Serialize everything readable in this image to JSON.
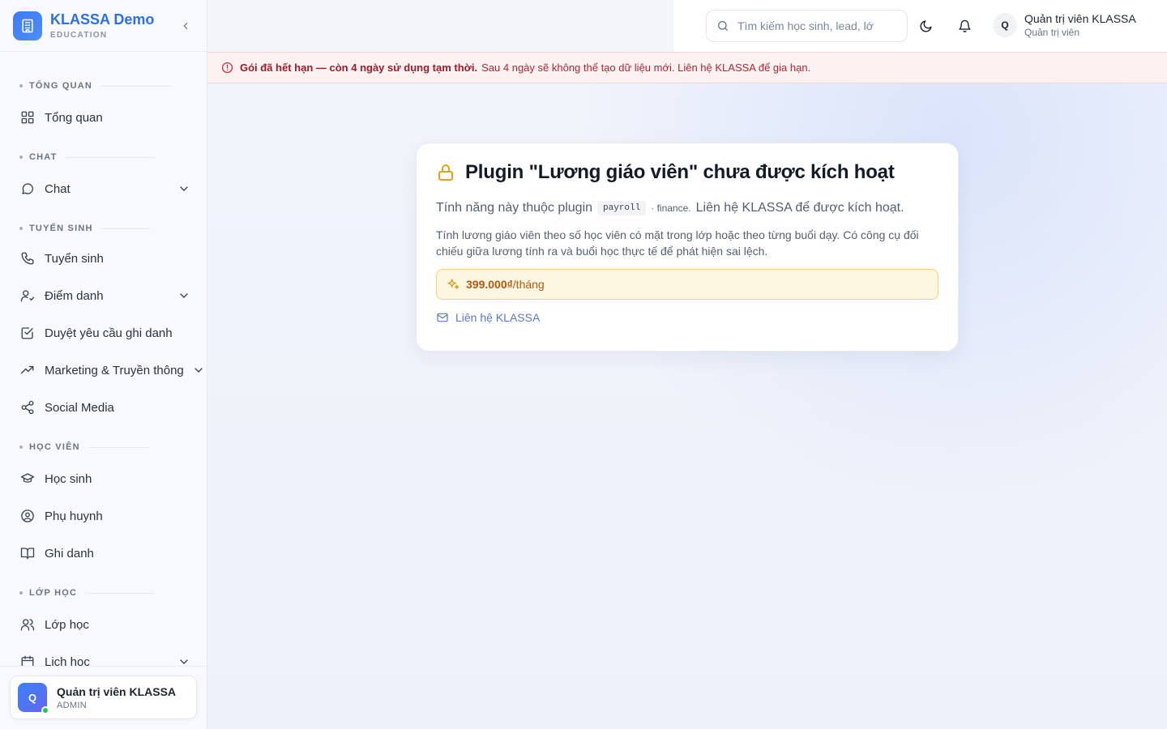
{
  "brand": {
    "name": "KLASSA Demo",
    "sub": "EDUCATION"
  },
  "sidebar": {
    "sections": [
      {
        "label": "TỔNG QUAN",
        "items": [
          {
            "label": "Tổng quan",
            "icon": "dashboard-icon",
            "chevron": false
          }
        ]
      },
      {
        "label": "CHAT",
        "items": [
          {
            "label": "Chat",
            "icon": "chat-icon",
            "chevron": true
          }
        ]
      },
      {
        "label": "TUYỂN SINH",
        "items": [
          {
            "label": "Tuyển sinh",
            "icon": "phone-icon",
            "chevron": false
          },
          {
            "label": "Điểm danh",
            "icon": "user-check-icon",
            "chevron": true
          },
          {
            "label": "Duyệt yêu cầu ghi danh",
            "icon": "checkbox-icon",
            "chevron": false
          },
          {
            "label": "Marketing & Truyền thông",
            "icon": "trending-icon",
            "chevron": true
          },
          {
            "label": "Social Media",
            "icon": "share-icon",
            "chevron": false
          }
        ]
      },
      {
        "label": "HỌC VIÊN",
        "items": [
          {
            "label": "Học sinh",
            "icon": "graduation-icon",
            "chevron": false
          },
          {
            "label": "Phụ huynh",
            "icon": "user-circle-icon",
            "chevron": false
          },
          {
            "label": "Ghi danh",
            "icon": "book-icon",
            "chevron": false
          }
        ]
      },
      {
        "label": "LỚP HỌC",
        "items": [
          {
            "label": "Lớp học",
            "icon": "users-icon",
            "chevron": false
          },
          {
            "label": "Lịch học",
            "icon": "calendar-icon",
            "chevron": true
          }
        ]
      }
    ],
    "user": {
      "initial": "Q",
      "name": "Quản trị viên KLASSA",
      "role": "ADMIN"
    }
  },
  "header": {
    "search_placeholder": "Tìm kiếm học sinh, lead, lớ",
    "user": {
      "initial": "Q",
      "name": "Quản trị viên KLASSA",
      "role": "Quản trị viên"
    }
  },
  "banner": {
    "bold": "Gói đã hết hạn — còn 4 ngày sử dụng tạm thời.",
    "rest": "Sau 4 ngày sẽ không thể tạo dữ liệu mới. Liên hệ KLASSA để gia hạn."
  },
  "card": {
    "title": "Plugin \"Lương giáo viên\" chưa được kích hoạt",
    "sub_prefix": "Tính năng này thuộc plugin",
    "plugin_code": "payroll",
    "category": "· finance.",
    "sub_suffix": "Liên hệ KLASSA để được kích hoạt.",
    "description": "Tính lương giáo viên theo số học viên có mặt trong lớp hoặc theo từng buổi dạy. Có công cụ đối chiếu giữa lương tính ra và buổi học thực tế để phát hiện sai lệch.",
    "price_amount": "399.000₫",
    "price_period": "/tháng",
    "contact_label": "Liên hệ KLASSA"
  },
  "colors": {
    "brand": "#2f6fe4",
    "danger": "#b42332",
    "warning": "#b2590c",
    "link": "#5b78c8"
  }
}
